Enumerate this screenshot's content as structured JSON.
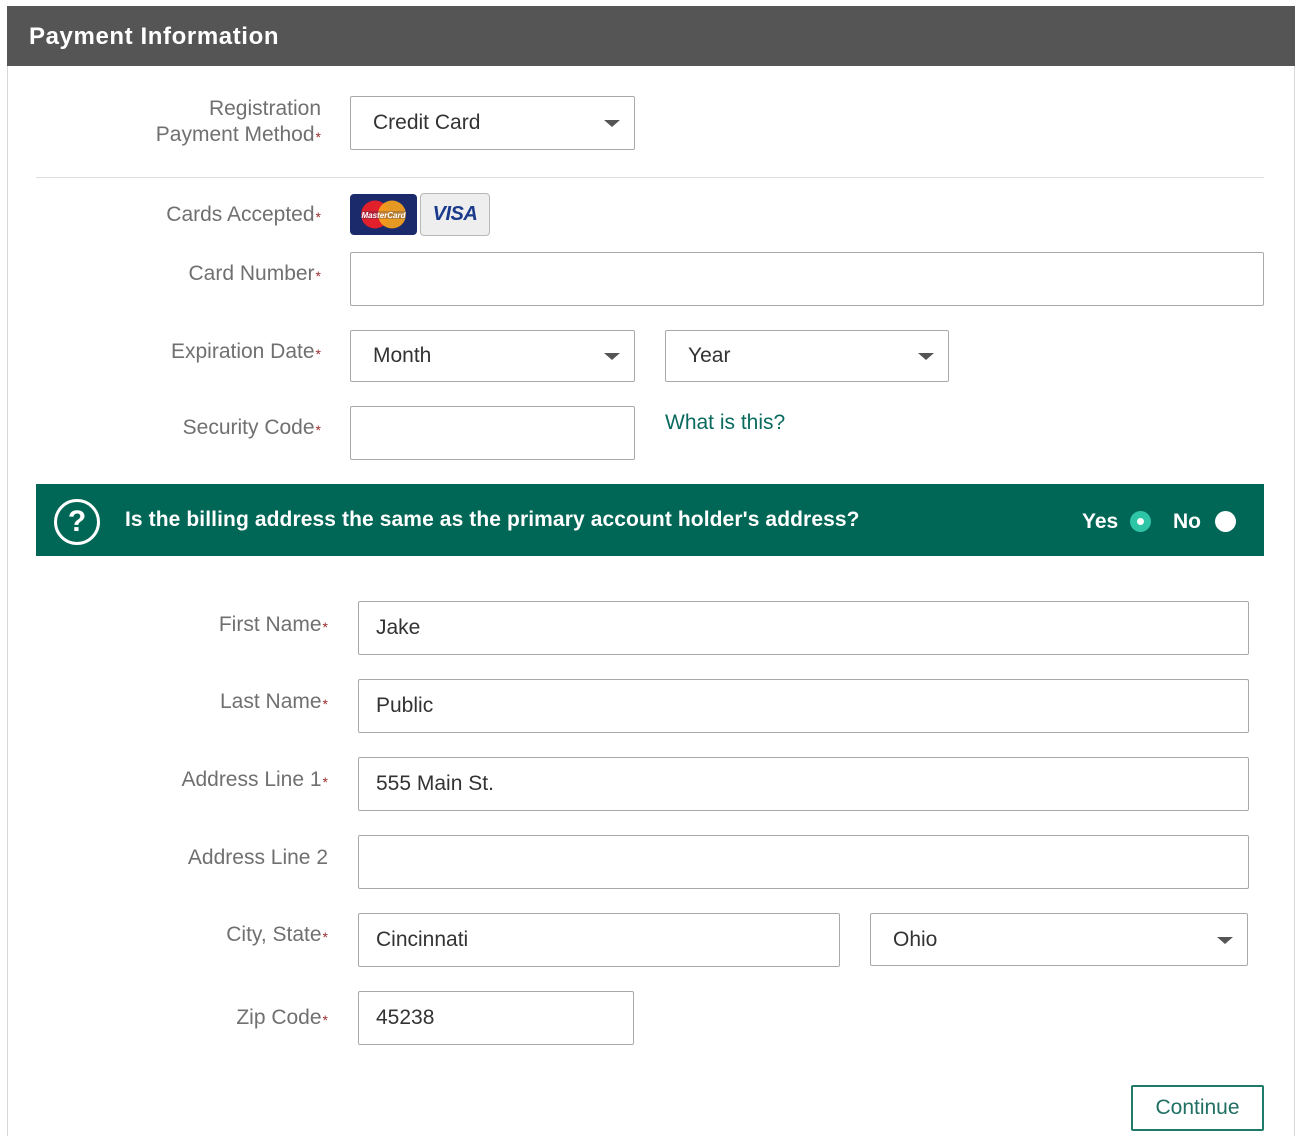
{
  "header": {
    "title": "Payment Information"
  },
  "payment": {
    "method_label_line1": "Registration",
    "method_label_line2": "Payment Method",
    "method_value": "Credit Card",
    "cards_label": "Cards Accepted",
    "cards": [
      "MasterCard",
      "VISA"
    ],
    "card_number_label": "Card Number",
    "card_number_value": "",
    "expiration_label": "Expiration Date",
    "month_value": "Month",
    "year_value": "Year",
    "security_label": "Security Code",
    "security_value": "",
    "security_help_link": "What is this?"
  },
  "billing_question": {
    "icon": "question-circle-icon",
    "text": "Is the billing address the same as the primary account holder's address?",
    "yes_label": "Yes",
    "no_label": "No",
    "selected": "Yes"
  },
  "billing": {
    "first_name_label": "First Name",
    "first_name_value": "Jake",
    "last_name_label": "Last Name",
    "last_name_value": "Public",
    "address1_label": "Address Line 1",
    "address1_value": "555 Main St.",
    "address2_label": "Address Line 2",
    "address2_value": "",
    "city_state_label": "City, State",
    "city_value": "Cincinnati",
    "state_value": "Ohio",
    "zip_label": "Zip Code",
    "zip_value": "45238"
  },
  "required_marker": "*",
  "actions": {
    "continue_label": "Continue"
  },
  "colors": {
    "header_bg": "#555555",
    "banner_bg": "#006655",
    "accent": "#2ec4a6",
    "required": "#9b2d2d"
  }
}
